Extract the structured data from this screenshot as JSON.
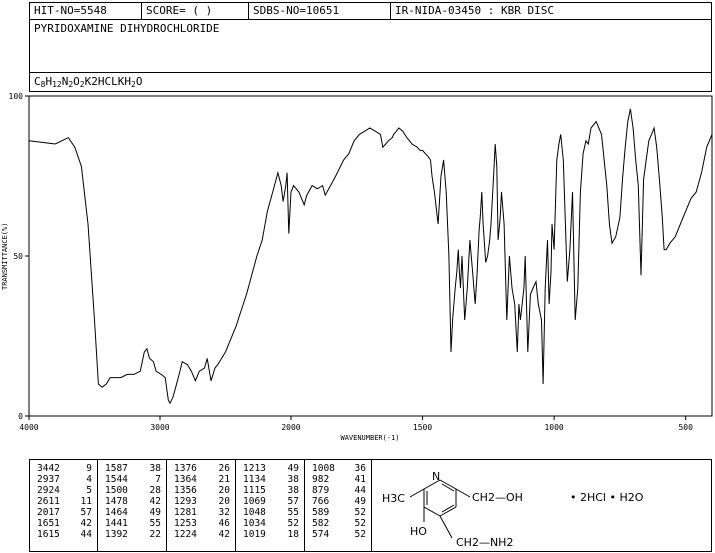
{
  "header": {
    "hit_no": "HIT-NO=5548",
    "score": "SCORE=  (  )",
    "sdbs_no": "SDBS-NO=10651",
    "ir_info": "IR-NIDA-03450 : KBR DISC",
    "compound_name": "PYRIDOXAMINE DIHYDROCHLORIDE",
    "formula_parts": [
      "C",
      "8",
      "H",
      "12",
      "N",
      "2",
      "O",
      "2",
      "K2HCL",
      "K",
      "H",
      "2",
      "O"
    ]
  },
  "chart_data": {
    "type": "line",
    "title": "",
    "xlabel": "WAVENUMBER(-1)",
    "ylabel": "TRANSMITTANCE(%)",
    "xlim": [
      4000,
      400
    ],
    "ylim": [
      0,
      100
    ],
    "xticks": [
      "4000",
      "3000",
      "2000",
      "1500",
      "1000",
      "500"
    ],
    "xtick_values": [
      4000,
      3000,
      2000,
      1500,
      1000,
      500
    ],
    "yticks": [
      "0",
      "50",
      "100"
    ],
    "ytick_values": [
      0,
      50,
      100
    ],
    "series": [
      {
        "x": [
          4000,
          3900,
          3800,
          3750,
          3700,
          3650,
          3600,
          3550,
          3500,
          3470,
          3442,
          3410,
          3380,
          3350,
          3300,
          3250,
          3200,
          3150,
          3120,
          3100,
          3080,
          3050,
          3030,
          2990,
          2960,
          2937,
          2924,
          2900,
          2860,
          2830,
          2790,
          2760,
          2730,
          2700,
          2660,
          2640,
          2611,
          2580,
          2560,
          2530,
          2500,
          2460,
          2420,
          2380,
          2340,
          2300,
          2260,
          2220,
          2180,
          2140,
          2100,
          2075,
          2060,
          2040,
          2030,
          2017,
          2000,
          1990,
          1970,
          1950,
          1940,
          1920,
          1900,
          1880,
          1870,
          1850,
          1830,
          1800,
          1780,
          1760,
          1740,
          1720,
          1700,
          1680,
          1660,
          1651,
          1640,
          1630,
          1615,
          1610,
          1600,
          1590,
          1575,
          1560,
          1540,
          1520,
          1510,
          1500,
          1490,
          1478,
          1470,
          1464,
          1455,
          1441,
          1430,
          1420,
          1410,
          1400,
          1392,
          1386,
          1376,
          1370,
          1364,
          1360,
          1356,
          1350,
          1340,
          1330,
          1320,
          1310,
          1300,
          1293,
          1285,
          1281,
          1275,
          1270,
          1260,
          1253,
          1245,
          1240,
          1230,
          1224,
          1218,
          1213,
          1205,
          1200,
          1190,
          1180,
          1170,
          1160,
          1150,
          1140,
          1134,
          1128,
          1115,
          1110,
          1100,
          1090,
          1080,
          1069,
          1060,
          1048,
          1042,
          1034,
          1025,
          1019,
          1012,
          1008,
          1000,
          990,
          982,
          975,
          965,
          950,
          940,
          930,
          920,
          910,
          900,
          890,
          879,
          870,
          860,
          840,
          820,
          800,
          790,
          780,
          766,
          750,
          740,
          730,
          720,
          710,
          700,
          690,
          680,
          670,
          660,
          650,
          640,
          630,
          620,
          610,
          600,
          589,
          582,
          574,
          560,
          540,
          520,
          500,
          480,
          460,
          440,
          420,
          400
        ],
        "y": [
          86,
          85.5,
          85,
          86,
          87,
          84,
          78,
          60,
          30,
          10,
          9,
          10,
          12,
          12,
          12,
          13,
          13,
          14,
          20,
          21,
          18,
          17,
          14,
          13,
          12,
          5,
          4,
          6,
          12,
          17,
          16,
          14,
          11,
          14,
          15,
          18,
          11,
          15,
          16,
          18,
          20,
          24,
          28,
          33,
          38,
          44,
          50,
          55,
          64,
          70,
          76,
          72,
          67,
          72,
          76,
          57,
          70,
          72,
          70,
          66,
          69,
          72,
          71,
          72,
          69,
          72,
          75,
          80,
          82,
          86,
          88,
          89,
          90,
          89,
          88,
          84,
          85,
          86,
          87,
          88,
          89,
          90,
          89,
          87,
          85,
          84,
          83,
          83,
          82,
          81,
          80,
          75,
          70,
          60,
          75,
          80,
          70,
          50,
          20,
          30,
          40,
          45,
          52,
          45,
          40,
          50,
          30,
          40,
          55,
          45,
          35,
          44,
          58,
          62,
          70,
          60,
          48,
          50,
          55,
          60,
          75,
          85,
          78,
          55,
          62,
          70,
          60,
          30,
          50,
          40,
          35,
          20,
          35,
          30,
          40,
          50,
          20,
          38,
          40,
          42,
          35,
          30,
          10,
          40,
          55,
          35,
          45,
          60,
          52,
          80,
          85,
          88,
          80,
          42,
          52,
          70,
          30,
          40,
          70,
          82,
          86,
          85,
          90,
          92,
          88,
          72,
          60,
          54,
          56,
          62,
          74,
          84,
          92,
          96,
          90,
          80,
          72,
          44,
          74,
          80,
          86,
          88,
          90,
          84,
          74,
          62,
          52,
          52,
          54,
          56,
          60,
          64,
          68,
          70,
          76,
          84,
          88
        ]
      }
    ],
    "peak_table": [
      [
        "3442",
        "9"
      ],
      [
        "2937",
        "4"
      ],
      [
        "2924",
        "5"
      ],
      [
        "2611",
        "11"
      ],
      [
        "2017",
        "57"
      ],
      [
        "1651",
        "42"
      ],
      [
        "1615",
        "44"
      ],
      [
        "1587",
        "38"
      ],
      [
        "1544",
        "7"
      ],
      [
        "1500",
        "28"
      ],
      [
        "1478",
        "42"
      ],
      [
        "1464",
        "49"
      ],
      [
        "1441",
        "55"
      ],
      [
        "1392",
        "22"
      ],
      [
        "1376",
        "26"
      ],
      [
        "1364",
        "21"
      ],
      [
        "1356",
        "20"
      ],
      [
        "1293",
        "20"
      ],
      [
        "1281",
        "32"
      ],
      [
        "1253",
        "46"
      ],
      [
        "1224",
        "42"
      ],
      [
        "1213",
        "49"
      ],
      [
        "1134",
        "38"
      ],
      [
        "1115",
        "38"
      ],
      [
        "1069",
        "57"
      ],
      [
        "1048",
        "55"
      ],
      [
        "1034",
        "52"
      ],
      [
        "1019",
        "18"
      ],
      [
        "1008",
        "36"
      ],
      [
        "982",
        "41"
      ],
      [
        "879",
        "44"
      ],
      [
        "766",
        "49"
      ],
      [
        "589",
        "52"
      ],
      [
        "582",
        "52"
      ],
      [
        "574",
        "52"
      ]
    ]
  },
  "structure": {
    "n_label": "N",
    "h3c_label": "H3C",
    "ho_label": "HO",
    "ch2oh_label": "CH2—OH",
    "ch2nh2_label": "CH2—NH2",
    "salt_label": "• 2HCl • H2O"
  }
}
